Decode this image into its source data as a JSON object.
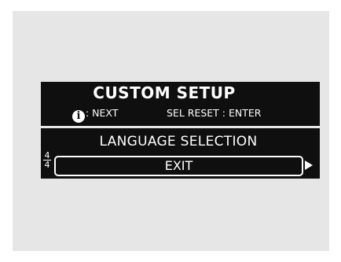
{
  "screen": {
    "title": "CUSTOM SETUP",
    "hints": {
      "info_icon_glyph": "i",
      "next": ": NEXT",
      "sel_reset": "SEL RESET : ENTER"
    },
    "menu": {
      "items": [
        {
          "label": "LANGUAGE SELECTION",
          "selected": false
        },
        {
          "label": "EXIT",
          "selected": true
        }
      ],
      "page_current": "4",
      "page_total": "4"
    },
    "icons": {
      "info": "info-icon",
      "more": "right-arrow-icon"
    },
    "colors": {
      "background": "#0f0f0f",
      "text": "#ffffff",
      "panel": "#e6e6e6"
    }
  }
}
